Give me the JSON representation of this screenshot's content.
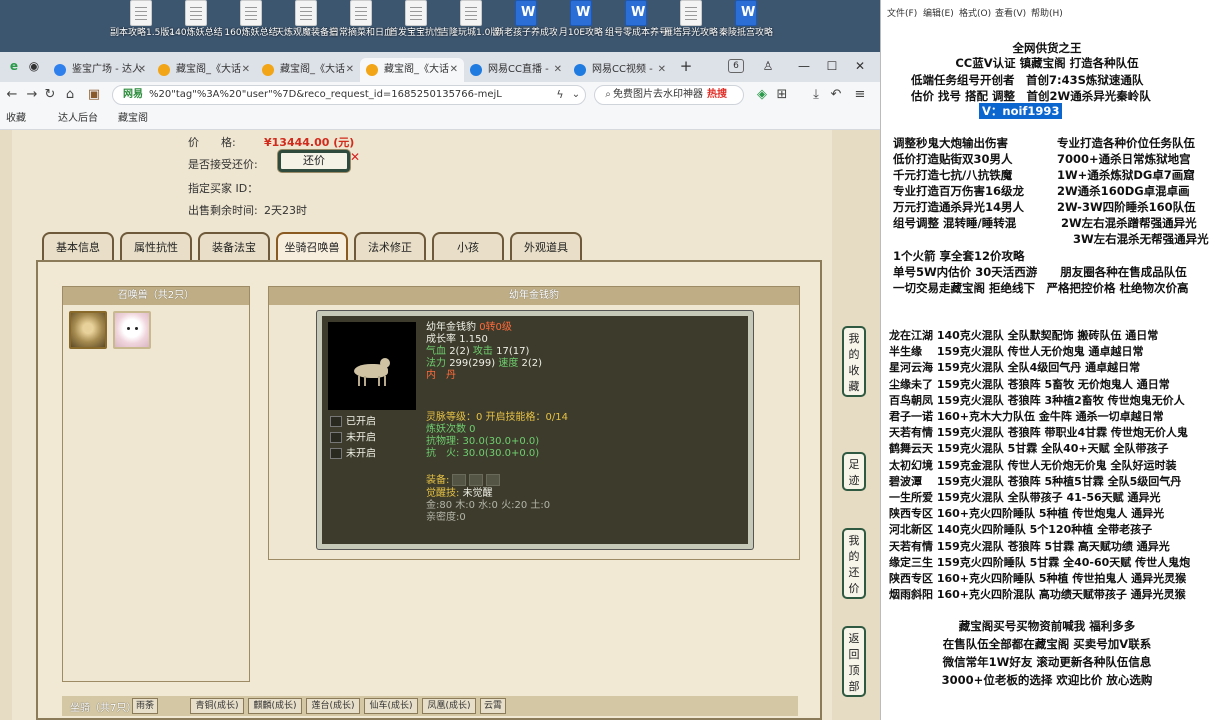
{
  "desktop": {
    "icons": [
      {
        "label": "副本攻略1.5版本",
        "kind": "doc"
      },
      {
        "label": "140炼妖总结",
        "kind": "doc"
      },
      {
        "label": "160炼妖总结",
        "kind": "doc"
      },
      {
        "label": "天炼观魔装备搭配",
        "kind": "doc"
      },
      {
        "label": "日常摘菜和日血魔搭配",
        "kind": "doc"
      },
      {
        "label": "首发宝宝抗性",
        "kind": "doc"
      },
      {
        "label": "吉隆玩城1.0版本",
        "kind": "doc"
      },
      {
        "label": "新老孩子养成攻略",
        "kind": "word"
      },
      {
        "label": "月10E攻略",
        "kind": "word"
      },
      {
        "label": "组号零成本养号",
        "kind": "word"
      },
      {
        "label": "雁塔异光攻略",
        "kind": "doc"
      },
      {
        "label": "秦陵抵宫攻略",
        "kind": "word"
      }
    ]
  },
  "browser": {
    "tabs": [
      {
        "label": "鉴宝广场 - 达人",
        "active": false,
        "color": "#2f80ed"
      },
      {
        "label": "藏宝阁_《大话",
        "active": false,
        "color": "#f2a516"
      },
      {
        "label": "藏宝阁_《大话",
        "active": false,
        "color": "#f2a516"
      },
      {
        "label": "藏宝阁_《大话",
        "active": true,
        "color": "#f2a516"
      },
      {
        "label": "网易CC直播 -",
        "active": false,
        "color": "#1f7be0"
      },
      {
        "label": "网易CC视频 -",
        "active": false,
        "color": "#1f7be0"
      }
    ],
    "new_tab": "+",
    "tab_count": "6",
    "url_site": "网易",
    "url": "%20\"tag\"%3A%20\"user\"%7D&reco_request_id=1685250135766-mejL",
    "search_text": "免费图片去水印神器",
    "search_hot": "热搜",
    "bookmarks": [
      "收藏",
      "达人后台",
      "藏宝阁"
    ]
  },
  "listing": {
    "price_label": "价　　格:",
    "price_value": "¥13444.00 (元)",
    "counter_label": "是否接受还价:",
    "counter_button": "还价",
    "buyer_label": "指定买家 ID：",
    "buyer_value": "",
    "time_label": "出售剩余时间:",
    "time_value": "2天23时"
  },
  "game_tabs": [
    {
      "label": "基本信息",
      "active": false
    },
    {
      "label": "属性抗性",
      "active": false
    },
    {
      "label": "装备法宝",
      "active": false
    },
    {
      "label": "坐骑召唤兽",
      "active": true
    },
    {
      "label": "法术修正",
      "active": false
    },
    {
      "label": "小孩",
      "active": false
    },
    {
      "label": "外观道具",
      "active": false
    }
  ],
  "summon": {
    "header": "召唤兽（共2只）",
    "pets": [
      "leopard",
      "alpaca"
    ],
    "detail_header": "幼年金钱豹",
    "name": "幼年金钱豹",
    "rebirth": "0转0级",
    "growth": "成长率 1.150",
    "hp_label": "气血",
    "hp": "2(2)",
    "atk_label": "攻击",
    "atk": "17(17)",
    "mp_label": "法力",
    "mp": "299(299)",
    "spd_label": "速度",
    "spd": "2(2)",
    "inner_dan": "内　丹",
    "slots": [
      "已开启",
      "未开启",
      "未开启"
    ],
    "spirit_level": "灵脉等级：0 开启技能格：0/14",
    "refine_count": "炼妖次数 0",
    "forget_resist": "抗物理: 30.0(30.0+0.0)",
    "fire_resist": "抗　火: 30.0(30.0+0.0)",
    "equip_label": "装备:",
    "awaken_label": "觉醒技:",
    "awaken_value": "未觉醒",
    "elements": "金:80 木:0 水:0 火:20 土:0",
    "intimacy": "亲密度:0"
  },
  "bottom_tabs": {
    "label": "坐骑（共7只）",
    "tabs": [
      "雨荼",
      "青铜(成长)",
      "麒麟(成长)",
      "莲台(成长)",
      "仙车(成长)",
      "凤凰(成长)",
      "云霄"
    ]
  },
  "side_buttons": [
    "我的收藏",
    "足迹",
    "我的还价",
    "返回顶部"
  ],
  "notepad": {
    "menu": [
      "文件(F)",
      "编辑(E)",
      "格式(O)",
      "查看(V)",
      "帮助(H)"
    ],
    "header_lines": [
      "全网供货之王",
      "CC蓝V认证 镇藏宝阁 打造各种队伍",
      "低端任务组号开创者　首创7:43S炼狱速通队",
      "估价 找号 搭配 调整　首创2W通杀异光秦岭队"
    ],
    "contact": "V：noif1993",
    "offers_left": [
      "调整秒鬼大炮输出伤害",
      "低价打造贴街双30男人",
      "千元打造七抗/八抗铁魔",
      "专业打造百万伤害16级龙",
      "万元打造通杀异光14男人",
      "组号调整 混转睡/睡转混"
    ],
    "offers_right": [
      "专业打造各种价位任务队伍",
      "7000+通杀日常炼狱地宫",
      "1W+通杀炼狱DG卓7画窟",
      "2W通杀160DG卓混卓画",
      "2W-3W四阶睡杀160队伍",
      "2W左右混杀蹭帮强通异光",
      "3W左右混杀无帮强通异光"
    ],
    "middle_lines": [
      "1个火箭 享全套12价攻略",
      "单号5W内估价 30天活西游　　朋友圈各种在售成品队伍",
      "一切交易走藏宝阁 拒绝线下　严格把控价格 杜绝物次价高"
    ],
    "team_lines": [
      "龙在江湖 140克火混队 全队默契配饰 搬砖队伍 通日常",
      "半生缘　 159克火混队 传世人无价炮鬼 通卓越日常",
      "星河云海 159克火混队 全队4级回气丹 通卓越日常",
      "尘缘未了 159克火混队 苍狼阵 5畜牧 无价炮鬼人 通日常",
      "百鸟朝凤 159克火混队 苍狼阵 3种植2畜牧 传世炮鬼无价人",
      "君子一诺 160+克木大力队伍 金牛阵 通杀一切卓越日常",
      "天若有情 159克火混队 苍狼阵 带职业4甘霖 传世炮无价人鬼",
      "鹤舞云天 159克火混队 5甘霖 全队40+天赋 全队带孩子",
      "太初幻境 159克金混队 传世人无价炮无价鬼 全队好运时装",
      "碧波潭　 159克火混队 苍狼阵 5种植5甘霖 全队5级回气丹",
      "一生所爱 159克火混队 全队带孩子 41-56天赋 通异光",
      "陕西专区 160+克火四阶睡队 5种植 传世炮鬼人 通异光",
      "河北新区 140克火四阶睡队 5个120种植 全带老孩子",
      "天若有情 159克火混队 苍狼阵 5甘霖 高天赋功绩 通异光",
      "缘定三生 159克火四阶睡队 5甘霖 全40-60天赋 传世人鬼炮",
      "陕西专区 160+克火四阶睡队 5种植 传世拍鬼人 通异光灵猴",
      "烟雨斜阳 160+克火四阶混队 高功绩天赋带孩子 通异光灵猴"
    ],
    "footer_lines": [
      "藏宝阁买号买物资前喊我 福利多多",
      "在售队伍全部都在藏宝阁 买卖号加V联系",
      "微信常年1W好友 滚动更新各种队伍信息",
      "3000+位老板的选择 欢迎比价 放心选购"
    ]
  },
  "colors": {
    "price": "#d02b1d",
    "selection": "#0b66d0",
    "panel_dark": "#3c3b2c"
  }
}
